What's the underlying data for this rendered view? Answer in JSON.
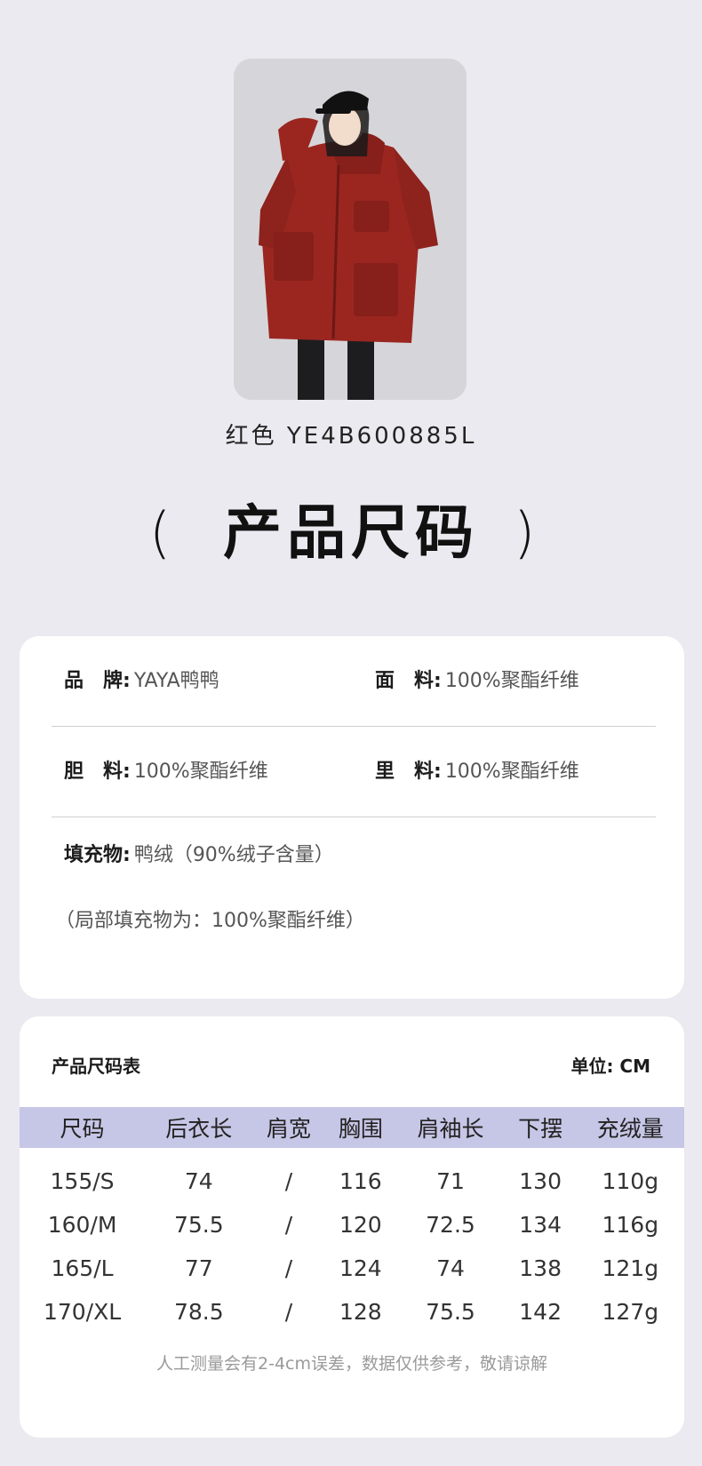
{
  "product": {
    "photo_alt": "model-in-red-hooded-down-jacket",
    "color_label": "红色 YE4B600885L"
  },
  "heading": {
    "open_paren": "(",
    "title": "产品尺码",
    "close_paren": ")"
  },
  "material": {
    "rows": [
      [
        {
          "key": "品　牌:",
          "value": "YAYA鸭鸭"
        },
        {
          "key": "面　料:",
          "value": "100%聚酯纤维"
        }
      ],
      [
        {
          "key": "胆　料:",
          "value": "100%聚酯纤维"
        },
        {
          "key": "里　料:",
          "value": "100%聚酯纤维"
        }
      ]
    ],
    "filling_key": "填充物:",
    "filling_value": "鸭绒（90%绒子含量）",
    "filling_note": "（局部填充物为：100%聚酯纤维）"
  },
  "size_chart": {
    "title": "产品尺码表",
    "unit": "单位: CM",
    "headers": [
      "尺码",
      "后衣长",
      "肩宽",
      "胸围",
      "肩袖长",
      "下摆",
      "充绒量"
    ],
    "rows": [
      [
        "155/S",
        "74",
        "/",
        "116",
        "71",
        "130",
        "110g"
      ],
      [
        "160/M",
        "75.5",
        "/",
        "120",
        "72.5",
        "134",
        "116g"
      ],
      [
        "165/L",
        "77",
        "/",
        "124",
        "74",
        "138",
        "121g"
      ],
      [
        "170/XL",
        "78.5",
        "/",
        "128",
        "75.5",
        "142",
        "127g"
      ]
    ],
    "note": "人工测量会有2-4cm误差，数据仅供参考，敬请谅解"
  },
  "colors": {
    "background": "#ebeaf0",
    "card": "#ffffff",
    "table_header": "#c6c6e6",
    "jacket": "#9b2620"
  }
}
